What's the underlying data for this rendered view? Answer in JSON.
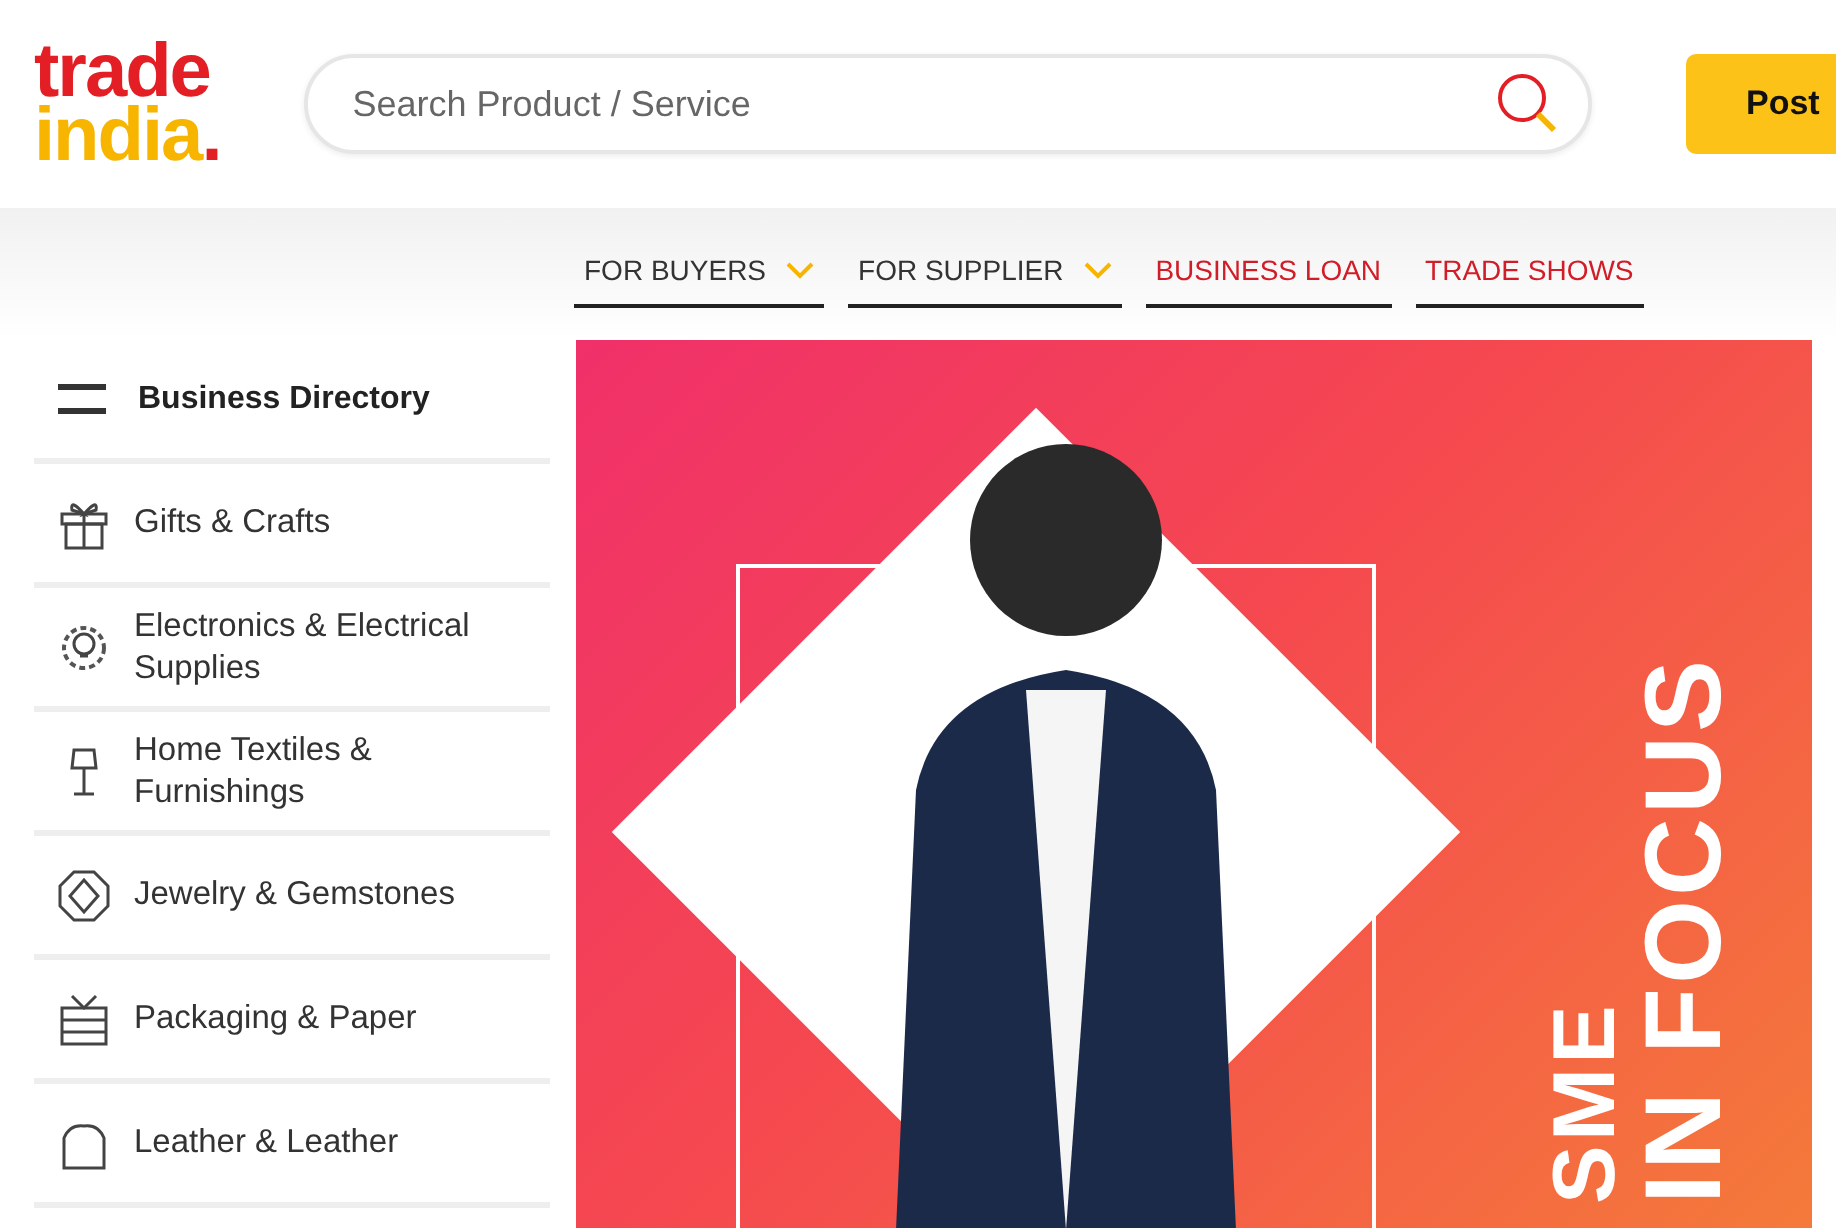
{
  "logo": {
    "line_1": "trade",
    "line_2": "india",
    "dot": "."
  },
  "search": {
    "placeholder": "Search Product / Service"
  },
  "post_button": "Post",
  "nav": [
    {
      "label": "FOR BUYERS",
      "kind": "dropdown"
    },
    {
      "label": "FOR SUPPLIER",
      "kind": "dropdown"
    },
    {
      "label": "BUSINESS LOAN",
      "kind": "link"
    },
    {
      "label": "TRADE SHOWS",
      "kind": "link"
    }
  ],
  "sidebar": {
    "title": "Business Directory",
    "items": [
      {
        "label": "Gifts & Crafts"
      },
      {
        "label": "Electronics & Electrical Supplies"
      },
      {
        "label": "Home Textiles & Furnishings"
      },
      {
        "label": "Jewelry & Gemstones"
      },
      {
        "label": "Packaging & Paper"
      },
      {
        "label": "Leather & Leather"
      }
    ]
  },
  "banner": {
    "lines": [
      "SME",
      "IN FOCUS"
    ]
  }
}
